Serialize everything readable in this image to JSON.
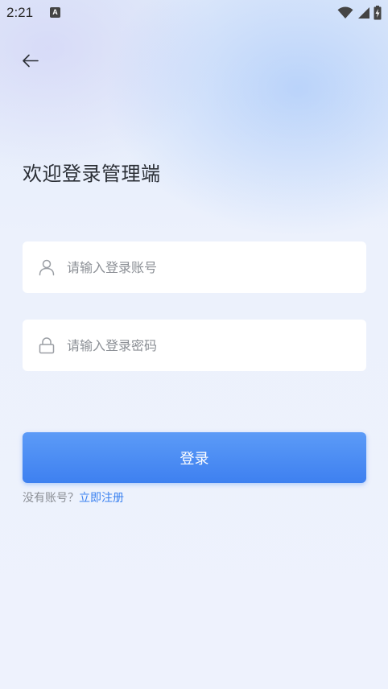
{
  "status_bar": {
    "time": "2:21",
    "notification_letter": "A",
    "icons": [
      "wifi-icon",
      "cellular-signal-icon",
      "battery-charging-icon"
    ]
  },
  "nav": {
    "back_icon": "arrow-left-icon"
  },
  "welcome": {
    "title": "欢迎登录管理端"
  },
  "form": {
    "account": {
      "icon": "user-icon",
      "placeholder": "请输入登录账号",
      "value": ""
    },
    "password": {
      "icon": "lock-icon",
      "placeholder": "请输入登录密码",
      "value": ""
    },
    "login_label": "登录"
  },
  "register": {
    "prompt": "没有账号？",
    "link": "立即注册"
  },
  "colors": {
    "accent": "#3E80F0",
    "title_text": "#2B2F36",
    "muted_text": "#8A8E94",
    "field_background": "#FFFFFF"
  }
}
